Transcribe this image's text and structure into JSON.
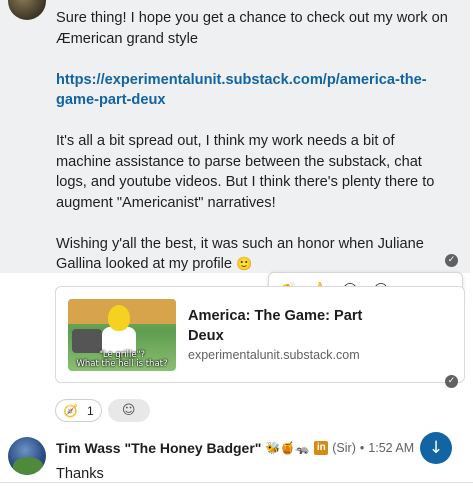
{
  "message1": {
    "para1": "Sure thing! I hope you get a chance to check out my work on Æmerican grand style",
    "link": "https://experimentalunit.substack.com/p/america-the-game-part-deux",
    "para3": "It's all a bit spread out, I think my work needs a bit of machine assistance to parse between the substack, chat logs, and youtube videos. But I think there's plenty there to augment \"Americanist\" narratives!",
    "para4": "Wishing y'all the best, it was such an honor when Juliane Gallina looked at my profile",
    "para4_emoji": "🙂",
    "check": "✓"
  },
  "hover_toolbar": {
    "items": [
      {
        "icon": "clap-emoji-icon",
        "glyph": "👏"
      },
      {
        "icon": "thumbs-up-emoji-icon",
        "glyph": "👍"
      },
      {
        "icon": "smile-emoji-icon",
        "glyph": "😊"
      },
      {
        "icon": "add-reaction-icon",
        "glyph": "☺"
      },
      {
        "icon": "reply-icon",
        "glyph": "↩"
      },
      {
        "icon": "more-icon",
        "glyph": "•••"
      }
    ]
  },
  "link_preview": {
    "title": "America: The Game: Part Deux",
    "domain": "experimentalunit.substack.com",
    "thumb_caption_1": "\"Le grille\"?",
    "thumb_caption_2": "What the hell is that?",
    "check": "✓"
  },
  "reactions": {
    "emoji": "🧭",
    "count": "1",
    "add_glyph": "☺"
  },
  "message2": {
    "author": "Tim Wass \"The Honey Badger\"",
    "status_emojis": "🐝🍯🦡",
    "linkedin_glyph": "in",
    "pronoun": "(Sir)",
    "separator": "•",
    "time": "1:52 AM",
    "text": "Thanks"
  },
  "scroll_button": {
    "glyph": "↓"
  },
  "colors": {
    "link": "#1264a3",
    "accent": "#1264a3"
  }
}
